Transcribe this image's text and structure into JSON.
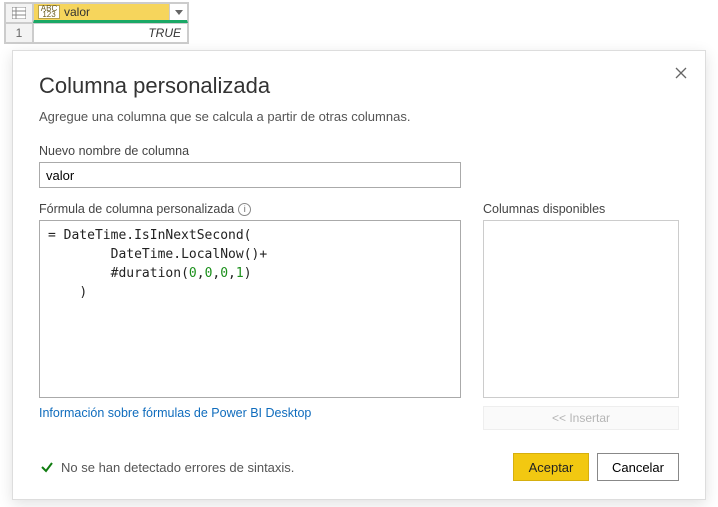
{
  "grid": {
    "column_header": "valor",
    "row_number": "1",
    "cell_value": "TRUE",
    "type_icon_top": "ABC",
    "type_icon_bottom": "123"
  },
  "dialog": {
    "title": "Columna personalizada",
    "subtitle": "Agregue una columna que se calcula a partir de otras columnas.",
    "name_label": "Nuevo nombre de columna",
    "name_value": "valor",
    "formula_label": "Fórmula de columna personalizada",
    "available_label": "Columnas disponibles",
    "insert_label": "<< Insertar",
    "learn_more": "Información sobre fórmulas de Power BI Desktop",
    "status_message": "No se han detectado errores de sintaxis.",
    "ok_label": "Aceptar",
    "cancel_label": "Cancelar",
    "formula": {
      "eq": "= ",
      "line1a": "DateTime.IsInNextSecond",
      "line1b": "(",
      "indent1": "        ",
      "line2a": "DateTime.LocalNow",
      "line2b": "()+",
      "indent2": "        ",
      "line3a": "#duration",
      "line3b": "(",
      "n0": "0",
      "comma": ",",
      "n1": "1",
      "line3c": ")",
      "indent3": "    ",
      "line4": ")"
    }
  }
}
